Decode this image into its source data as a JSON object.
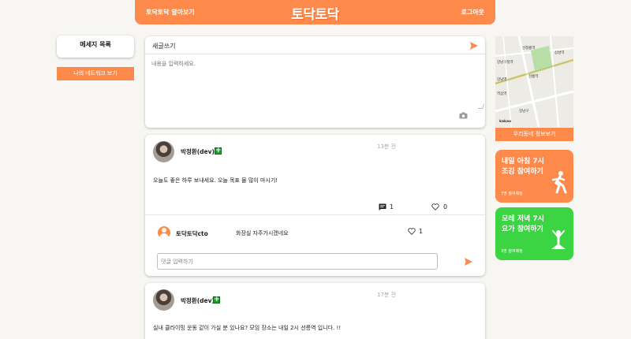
{
  "header": {
    "nav_left": "토닥토닥 알아보기",
    "logo": "토닥토닥",
    "nav_right": "로그아웃",
    "accent": "#fd8a4a"
  },
  "left": {
    "message_list": "메세지 목록",
    "network_button": "나의 네트워크 보기"
  },
  "compose": {
    "title": "새글쓰기",
    "placeholder": "내용을 입력하세요."
  },
  "posts": [
    {
      "author": "박정환(dev)",
      "time": "13분 전",
      "content": "오늘도 좋은 하루 보내세요. 오늘 목표 물 많이 마시기!",
      "comment_count": "1",
      "like_count": "0",
      "comment": {
        "author": "토닥토닥cto",
        "text": "화장실 자주가시겠네요",
        "like_count": "1"
      },
      "comment_placeholder": "댓글 입력하기"
    },
    {
      "author": "박정환(dev)",
      "time": "17분 전",
      "content": "실내 클라이밍 운동 같이 가실 분 있나요? 모임 장소는 내일 2시 선릉역 입니다. !!"
    }
  ],
  "right": {
    "map_labels": [
      "선정릉역",
      "강남구청역",
      "삼성역",
      "선릉역",
      "강남역",
      "역삼역",
      "강남구",
      "kakao"
    ],
    "map_button": "우리동네 정보보기",
    "activities": [
      {
        "line1": "내일 아침 7시",
        "line2": "조깅 참여하기",
        "sub": "7명 참여예정",
        "color": "#fd8a4a"
      },
      {
        "line1": "모레 저녁 7시",
        "line2": "요가 참여하기",
        "sub": "3명 참여예정",
        "color": "#3bd442"
      }
    ]
  }
}
